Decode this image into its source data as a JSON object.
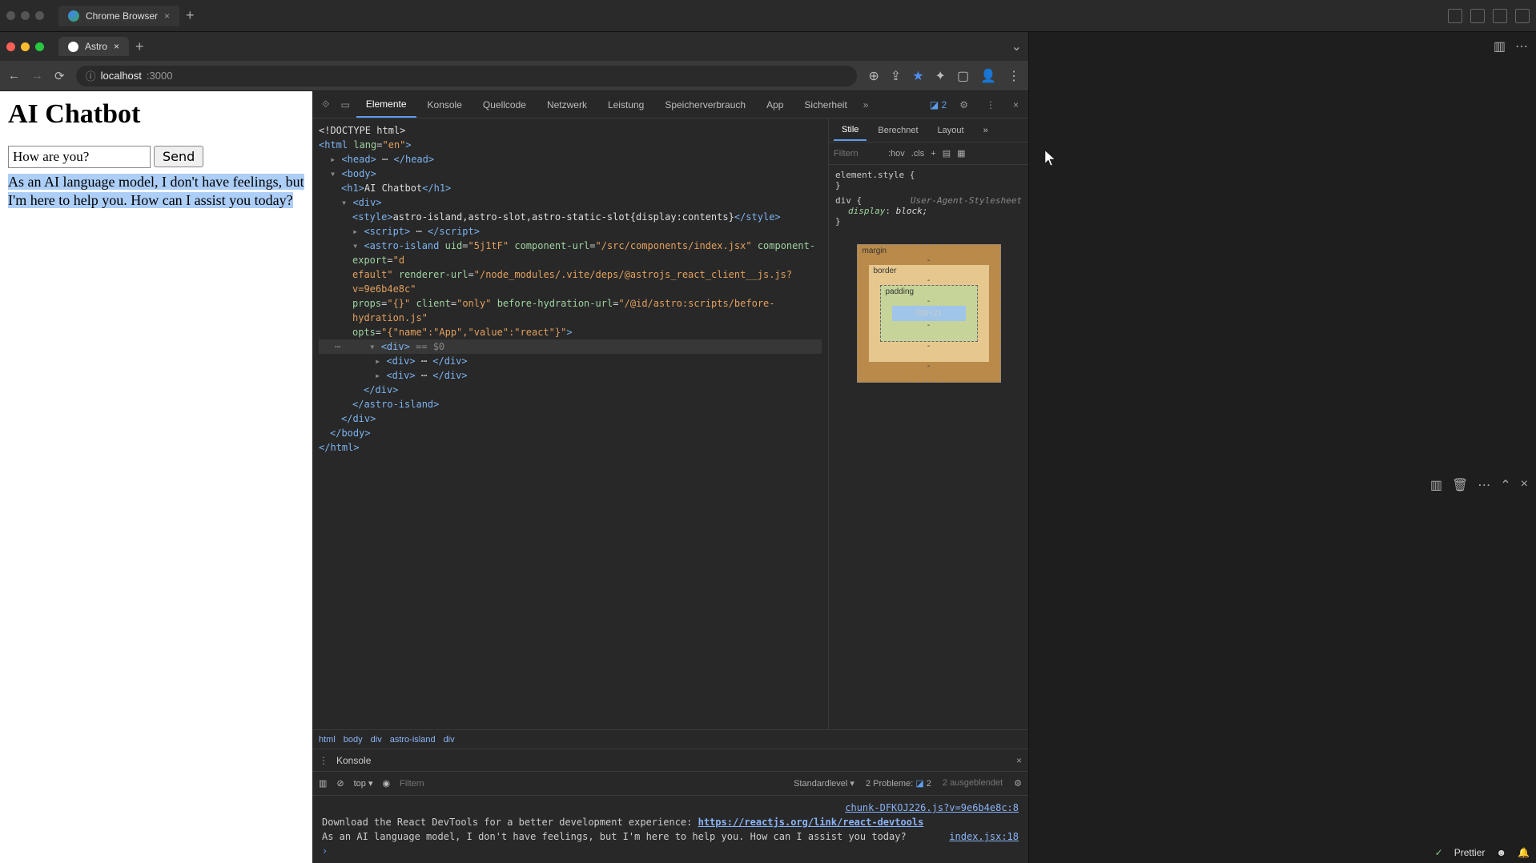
{
  "outerTab": {
    "title": "Chrome Browser"
  },
  "browserTab": {
    "title": "Astro"
  },
  "url": {
    "host": "localhost",
    "path": ":3000"
  },
  "page": {
    "heading": "AI Chatbot",
    "inputValue": "How are you?",
    "sendLabel": "Send",
    "response": "As an AI language model, I don't have feelings, but I'm here to help you. How can I assist you today?"
  },
  "devtools": {
    "tabs": [
      "Elemente",
      "Konsole",
      "Quellcode",
      "Netzwerk",
      "Leistung",
      "Speicherverbrauch",
      "App",
      "Sicherheit"
    ],
    "issuesCount": "2",
    "dom": {
      "doctype": "<!DOCTYPE html>",
      "htmlOpen": "html",
      "htmlAttr": "lang",
      "htmlVal": "\"en\"",
      "head": "head",
      "body": "body",
      "h1Text": "AI Chatbot",
      "styleText": "astro-island,astro-slot,astro-static-slot{display:contents}",
      "scriptDots": "…",
      "astroIslandAttrs": "uid=\"5j1tF\" component-url=\"/src/components/index.jsx\" component-export=\"default\" renderer-url=\"/node_modules/.vite/deps/@astrojs_react_client__js.js?v=9e6b4e8c\" props=\"{}\" client=\"only\" before-hydration-url=\"/@id/astro:scripts/before-hydration.js\" opts=\"{\\\"name\\\":\\\"App\\\",\\\"value\\\":\\\"react\\\"}\"",
      "selSuffix": " == $0"
    },
    "breadcrumb": [
      "html",
      "body",
      "div",
      "astro-island",
      "div"
    ],
    "stylesTabs": [
      "Stile",
      "Berechnet",
      "Layout"
    ],
    "filterPlaceholder": "Filtern",
    "hov": ":hov",
    "cls": ".cls",
    "rule1": "element.style {",
    "rule1End": "}",
    "rule2Sel": "div {",
    "rule2Src": "User-Agent-Stylesheet",
    "rule2Prop": "display",
    "rule2Val": "block;",
    "rule2End": "}",
    "boxModel": {
      "margin": "margin",
      "border": "border",
      "padding": "padding",
      "content": "308×21"
    }
  },
  "consoleDrawer": {
    "tab": "Konsole",
    "context": "top",
    "filterPlaceholder": "Filtern",
    "level": "Standardlevel",
    "problems": "2 Probleme:",
    "problemsBadge": "2",
    "hidden": "2 ausgeblendet",
    "line1Msg": "Download the React DevTools for a better development experience: ",
    "line1Link": "https://reactjs.org/link/react-devtools",
    "line1Src": "chunk-DFKOJ226.js?v=9e6b4e8c:8",
    "line2Msg": "As an AI language model, I don't have feelings, but I'm here to help you. How can I assist you today?",
    "line2Src": "index.jsx:18"
  },
  "statusBar": {
    "prettier": "Prettier"
  }
}
